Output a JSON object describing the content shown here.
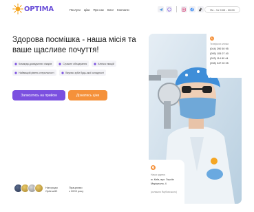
{
  "logo": {
    "text": "OPTIMA"
  },
  "nav": [
    "Послуги",
    "Ціни",
    "Про нас",
    "Блог",
    "Контакти"
  ],
  "socials": [
    "telegram-icon",
    "viber-icon",
    "instagram-icon",
    "facebook-icon",
    "tiktok-icon"
  ],
  "hours": "Пн - Чт   9:00 - 20:00",
  "hero": {
    "title": "Здорова посмішка - наша місія та ваше щасливе почуття!",
    "features": [
      {
        "icon": "team-icon",
        "label": "Команда досвідчених лікарів"
      },
      {
        "icon": "equipment-icon",
        "label": "Сучасне обладнання"
      },
      {
        "icon": "clinic-icon",
        "label": "Клініка емоцій"
      },
      {
        "icon": "results-icon",
        "label": "Найвищий рівень стерильності"
      },
      {
        "icon": "kids-icon",
        "label": "Лікуємо зуби будь-якої складності"
      }
    ],
    "primary_button": "Записатись на прийом",
    "secondary_button": "Дізнатись ціни"
  },
  "awards": {
    "label_line1": "Нагороди",
    "label_line2": "Optima32",
    "since_line1": "Працюємо",
    "since_line2": "з 2009 року"
  },
  "contact": {
    "caption": "Телефони клініки",
    "phones": [
      "(044) 290 50 95",
      "(095) 105 07 40",
      "(093) 114 80 44",
      "(098) 047 00 05"
    ]
  },
  "address": {
    "caption": "Наша адреса",
    "line1": "м. Київ, вул. Героїв",
    "line2": "Маріуполя, 4",
    "note": "(колишня Якубовського)"
  },
  "colors": {
    "brand_purple": "#7b50e0",
    "brand_orange": "#f5913a"
  }
}
